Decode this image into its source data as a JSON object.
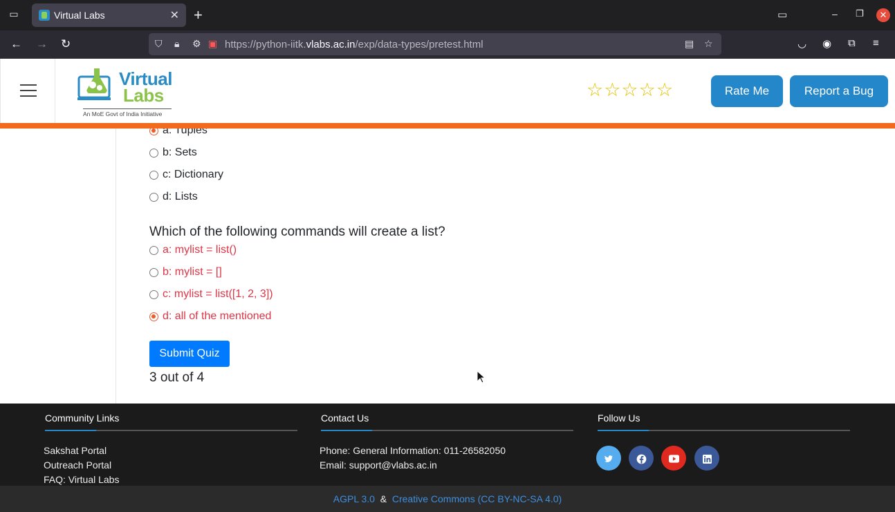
{
  "browser": {
    "tab_title": "Virtual Labs",
    "url_prefix": "https://python-iitk.",
    "url_domain": "vlabs.ac.in",
    "url_suffix": "/exp/data-types/pretest.html"
  },
  "header": {
    "logo_word1": "Virtual",
    "logo_word2": "Labs",
    "logo_tagline": "An MoE Govt of India Initiative",
    "stars": "☆☆☆☆☆",
    "rate_button": "Rate Me",
    "bug_button": "Report a Bug"
  },
  "quiz": {
    "prev_options": [
      {
        "label": "a: Tuples",
        "checked": true
      },
      {
        "label": "b: Sets",
        "checked": false
      },
      {
        "label": "c: Dictionary",
        "checked": false
      },
      {
        "label": "d: Lists",
        "checked": false
      }
    ],
    "question": "Which of the following commands will create a list?",
    "options": [
      {
        "label": "a: mylist = list()",
        "checked": false
      },
      {
        "label": "b: mylist = []",
        "checked": false
      },
      {
        "label": "c: mylist = list([1, 2, 3])",
        "checked": false
      },
      {
        "label": "d: all of the mentioned",
        "checked": true
      }
    ],
    "submit_label": "Submit Quiz",
    "score": "3 out of 4"
  },
  "footer": {
    "community": {
      "heading": "Community Links",
      "links": [
        "Sakshat Portal",
        "Outreach Portal",
        "FAQ: Virtual Labs"
      ]
    },
    "contact": {
      "heading": "Contact Us",
      "phone": "Phone: General Information: 011-26582050",
      "email": "Email: support@vlabs.ac.in"
    },
    "follow": {
      "heading": "Follow Us",
      "icons": [
        "twitter-icon",
        "facebook-icon",
        "youtube-icon",
        "linkedin-icon"
      ]
    },
    "license_1": "AGPL 3.0",
    "license_sep": "&",
    "license_2": "Creative Commons (CC BY-NC-SA 4.0)"
  },
  "colors": {
    "accent_orange": "#f26b1d",
    "button_blue": "#2487c9",
    "submit_blue": "#007bff",
    "answer_red": "#dc3545"
  }
}
